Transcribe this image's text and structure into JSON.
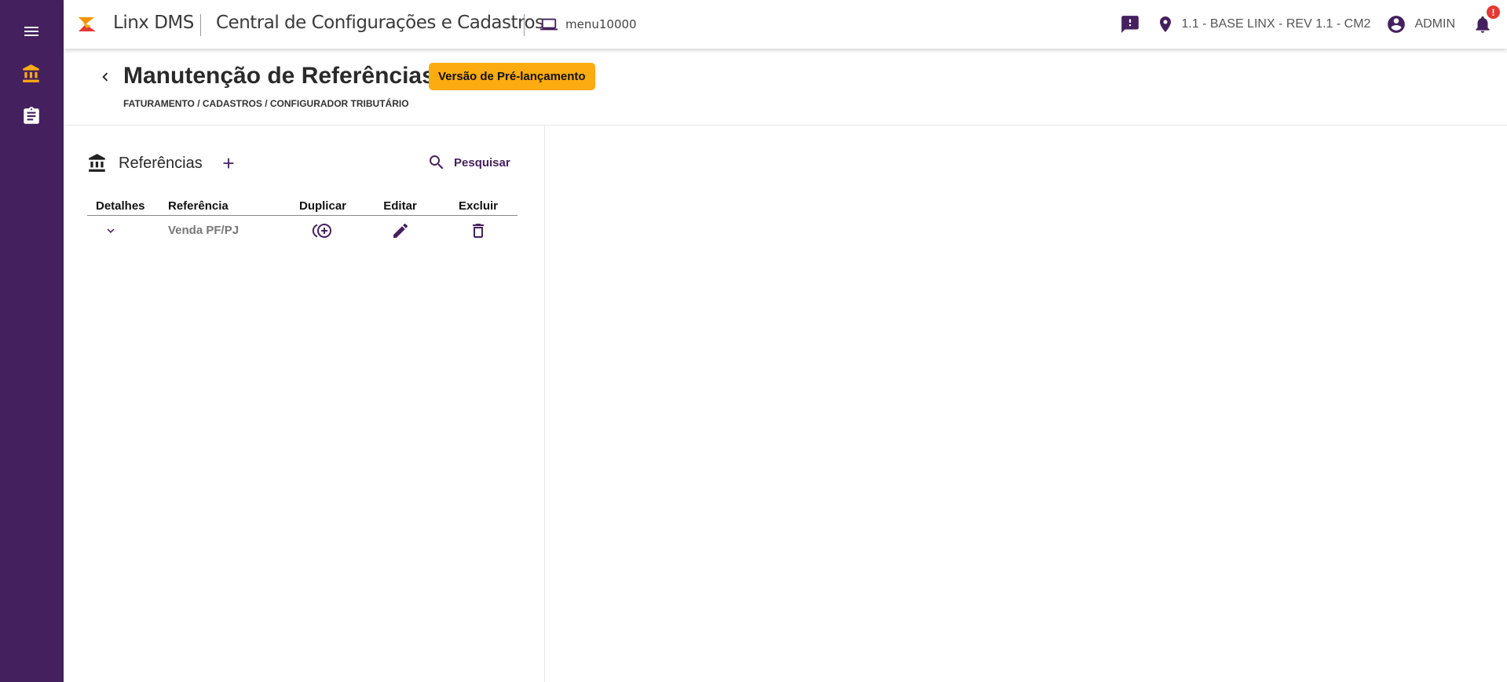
{
  "topbar": {
    "brand": "Linx DMS",
    "app_title": "Central de Configurações e Cadastros",
    "menu_code": "menu10000",
    "location": "1.1 - BASE LINX - REV 1.1 - CM2",
    "user": "ADMIN",
    "notification_badge": "!"
  },
  "sidebar": {
    "items": [
      {
        "icon": "menu-icon"
      },
      {
        "icon": "bank-icon",
        "active": true
      },
      {
        "icon": "clipboard-icon"
      }
    ]
  },
  "header": {
    "title": "Manutenção de Referências",
    "badge": "Versão de Pré-lançamento",
    "breadcrumb": "FATURAMENTO / CADASTROS / CONFIGURADOR TRIBUTÁRIO"
  },
  "panel": {
    "title": "Referências",
    "search_label": "Pesquisar",
    "columns": [
      "Detalhes",
      "Referência",
      "Duplicar",
      "Editar",
      "Excluir"
    ],
    "rows": [
      {
        "referencia": "Venda PF/PJ"
      }
    ]
  },
  "colors": {
    "primary": "#45205e",
    "accent": "#fcab10",
    "alert": "#e53935"
  }
}
